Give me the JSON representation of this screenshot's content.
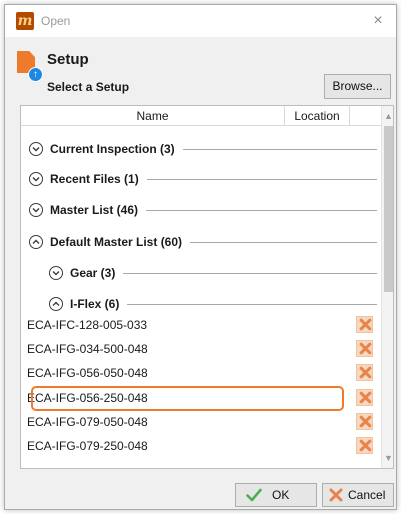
{
  "window": {
    "title": "Open",
    "app_logo_letter": "m",
    "close_glyph": "×"
  },
  "header": {
    "title": "Setup",
    "subtitle": "Select a Setup",
    "browse_label": "Browse...",
    "doc_badge_glyph": "↑"
  },
  "list": {
    "columns": {
      "name": "Name",
      "location": "Location"
    },
    "groups": [
      {
        "label": "Current Inspection (3)",
        "expanded": false
      },
      {
        "label": "Recent Files (1)",
        "expanded": false
      },
      {
        "label": "Master List (46)",
        "expanded": false
      },
      {
        "label": "Default Master List (60)",
        "expanded": true
      },
      {
        "label": "Gear (3)",
        "expanded": false
      },
      {
        "label": "I-Flex (6)",
        "expanded": true
      }
    ],
    "items": [
      {
        "name": "ECA-IFC-128-005-033"
      },
      {
        "name": "ECA-IFG-034-500-048"
      },
      {
        "name": "ECA-IFG-056-050-048"
      },
      {
        "name": "ECA-IFG-056-250-048",
        "highlighted": true
      },
      {
        "name": "ECA-IFG-079-050-048"
      },
      {
        "name": "ECA-IFG-079-250-048"
      }
    ]
  },
  "footer": {
    "ok_label": "OK",
    "cancel_label": "Cancel"
  },
  "colors": {
    "accent": "#ee7a2c",
    "ok_check": "#4caf50",
    "cancel_x": "#e8834a",
    "badge": "#1e88e5"
  }
}
